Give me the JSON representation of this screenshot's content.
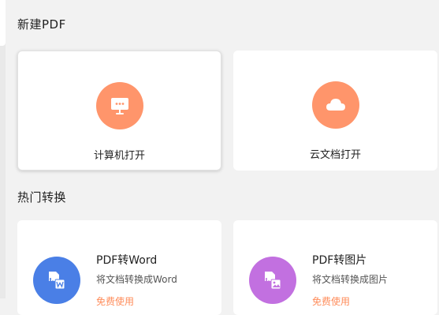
{
  "sections": {
    "new_pdf": "新建PDF",
    "hot_convert": "热门转换"
  },
  "open_cards": [
    {
      "label": "计算机打开",
      "icon": "computer-monitor-icon",
      "color": "#ff956b",
      "selected": true
    },
    {
      "label": "云文档打开",
      "icon": "cloud-icon",
      "color": "#ff956b",
      "selected": false
    }
  ],
  "convert_cards": [
    {
      "title": "PDF转Word",
      "desc": "将文档转换成Word",
      "icon": "pdf-to-word-icon",
      "color": "#4a7fe6",
      "foot": "免费使用"
    },
    {
      "title": "PDF转图片",
      "desc": "将文档转换成图片",
      "icon": "pdf-to-image-icon",
      "color": "#c270e0",
      "foot": "免费使用"
    }
  ],
  "colors": {
    "background": "#f2f2f2",
    "card": "#ffffff",
    "accent": "#ff956b"
  }
}
